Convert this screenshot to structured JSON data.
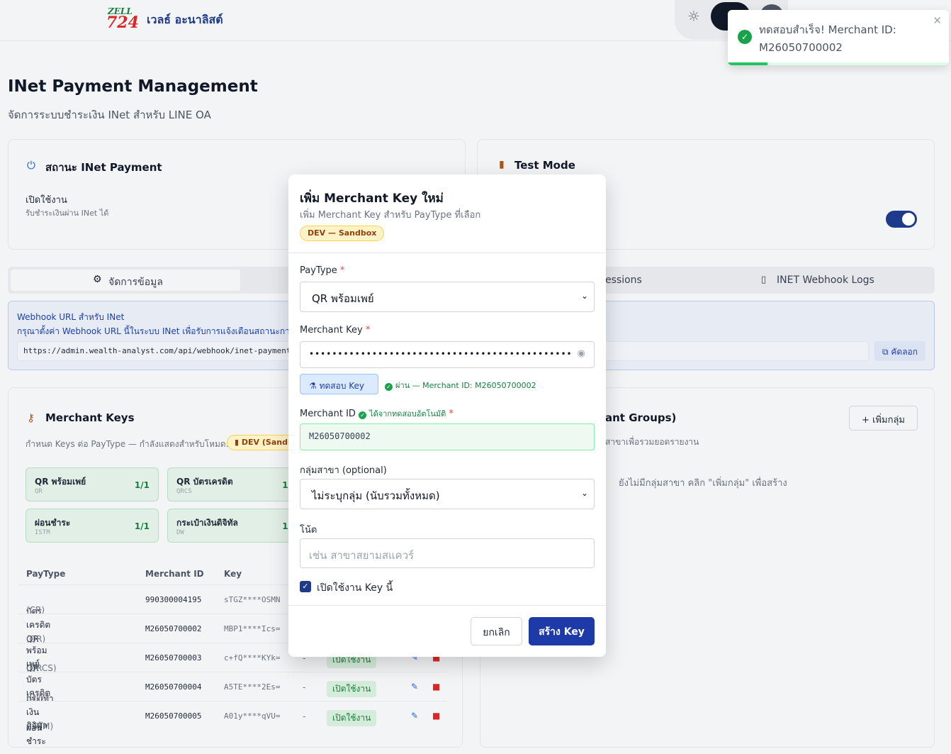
{
  "header": {
    "logo_top": "ZELL",
    "logo_bottom": "724",
    "brand": "เวลธ์ อะนาลิสต์"
  },
  "page": {
    "title": "INet Payment Management",
    "subtitle": "จัดการระบบชำระเงิน INet สำหรับ LINE OA"
  },
  "status_card": {
    "title": "สถานะ INet Payment",
    "enable_label": "เปิดใช้งาน",
    "enable_desc": "รับชำระเงินผ่าน INet ได้"
  },
  "test_card": {
    "title": "Test Mode",
    "toggle_on": true
  },
  "tabs": [
    {
      "label": "จัดการข้อมูล"
    },
    {
      "label": "essions"
    },
    {
      "label": "INET Webhook Logs"
    }
  ],
  "webhook": {
    "title": "Webhook URL สำหรับ INet",
    "desc": "กรุณาตั้งค่า Webhook URL นี้ในระบบ INet เพื่อรับการแจ้งเตือนสถานะการช",
    "url": "https://admin.wealth-analyst.com/api/webhook/inet-payment",
    "copy_label": "คัดลอก"
  },
  "merchant_keys": {
    "title": "Merchant Keys",
    "desc": "กำหนด Keys ต่อ PayType — กำลังแสดงสำหรับโหมด:",
    "mode_badge": "DEV (Sandb",
    "tiles": [
      {
        "name": "QR พร้อมเพย์",
        "code": "QR",
        "count": "1/1"
      },
      {
        "name": "QR บัตรเครดิต",
        "code": "QRCS",
        "count": "1/"
      },
      {
        "name": "ผ่อนชำระ",
        "code": "ISTM",
        "count": "1/1"
      },
      {
        "name": "กระเป๋าเงินดิจิทัล",
        "code": "DW",
        "count": "1/"
      }
    ],
    "columns": [
      "PayType",
      "Merchant ID",
      "Key"
    ],
    "rows": [
      {
        "paytype": "บัตรเครดิต",
        "code": "(CR)",
        "mid": "990300004195",
        "key": "sTGZ****OSMN",
        "dash": "",
        "status": ""
      },
      {
        "paytype": "QR พร้อมเพย์",
        "code": "(QR)",
        "mid": "M26050700002",
        "key": "MBP1****Ics=",
        "dash": "",
        "status": ""
      },
      {
        "paytype": "QR บัตรเครดิต",
        "code": "(QRCS)",
        "mid": "M26050700003",
        "key": "c+fQ****KYk=",
        "dash": "-",
        "status": "เปิดใช้งาน"
      },
      {
        "paytype": "กระเป๋าเงินดิจิทัล",
        "code": "(DW)",
        "mid": "M26050700004",
        "key": "A5TE****2Es=",
        "dash": "-",
        "status": "เปิดใช้งาน"
      },
      {
        "paytype": "ผ่อนชำระ",
        "code": "(ISTM)",
        "mid": "M26050700005",
        "key": "A01y****qVU=",
        "dash": "-",
        "status": "เปิดใช้งาน"
      }
    ]
  },
  "groups": {
    "title": "ant Groups)",
    "desc": "สาขาเพื่อรวมยอดรายงาน",
    "add_label": "+ เพิ่มกลุ่ม",
    "empty": "ยังไม่มีกลุ่มสาขา คลิก \"เพิ่มกลุ่ม\" เพื่อสร้าง"
  },
  "modal": {
    "title": "เพิ่ม Merchant Key ใหม่",
    "subtitle": "เพิ่ม Merchant Key สำหรับ PayType ที่เลือก",
    "env_badge": "DEV — Sandbox",
    "paytype_label": "PayType",
    "paytype_value": "QR พร้อมเพย์",
    "key_label": "Merchant Key",
    "key_value": "••••••••••••••••••••••••••••••••••••••••••••••",
    "test_label": "ทดสอบ Key",
    "test_result": "ผ่าน — Merchant ID: M26050700002",
    "mid_label": "Merchant ID",
    "mid_auto": "ได้จากทดสอบอัตโนมัติ",
    "mid_value": "M26050700002",
    "group_label": "กลุ่มสาขา (optional)",
    "group_value": "ไม่ระบุกลุ่ม (นับรวมทั้งหมด)",
    "note_label": "โน้ต",
    "note_placeholder": "เช่น สาขาสยามสแควร์",
    "enable_label": "เปิดใช้งาน Key นี้",
    "cancel_label": "ยกเลิก",
    "create_label": "สร้าง Key"
  },
  "toast": {
    "message": "ทดสอบสำเร็จ! Merchant ID: M26050700002",
    "progress": 0.18
  },
  "colors": {
    "primary": "#1e3aa8",
    "success": "#16a34a",
    "danger": "#dc2626"
  }
}
